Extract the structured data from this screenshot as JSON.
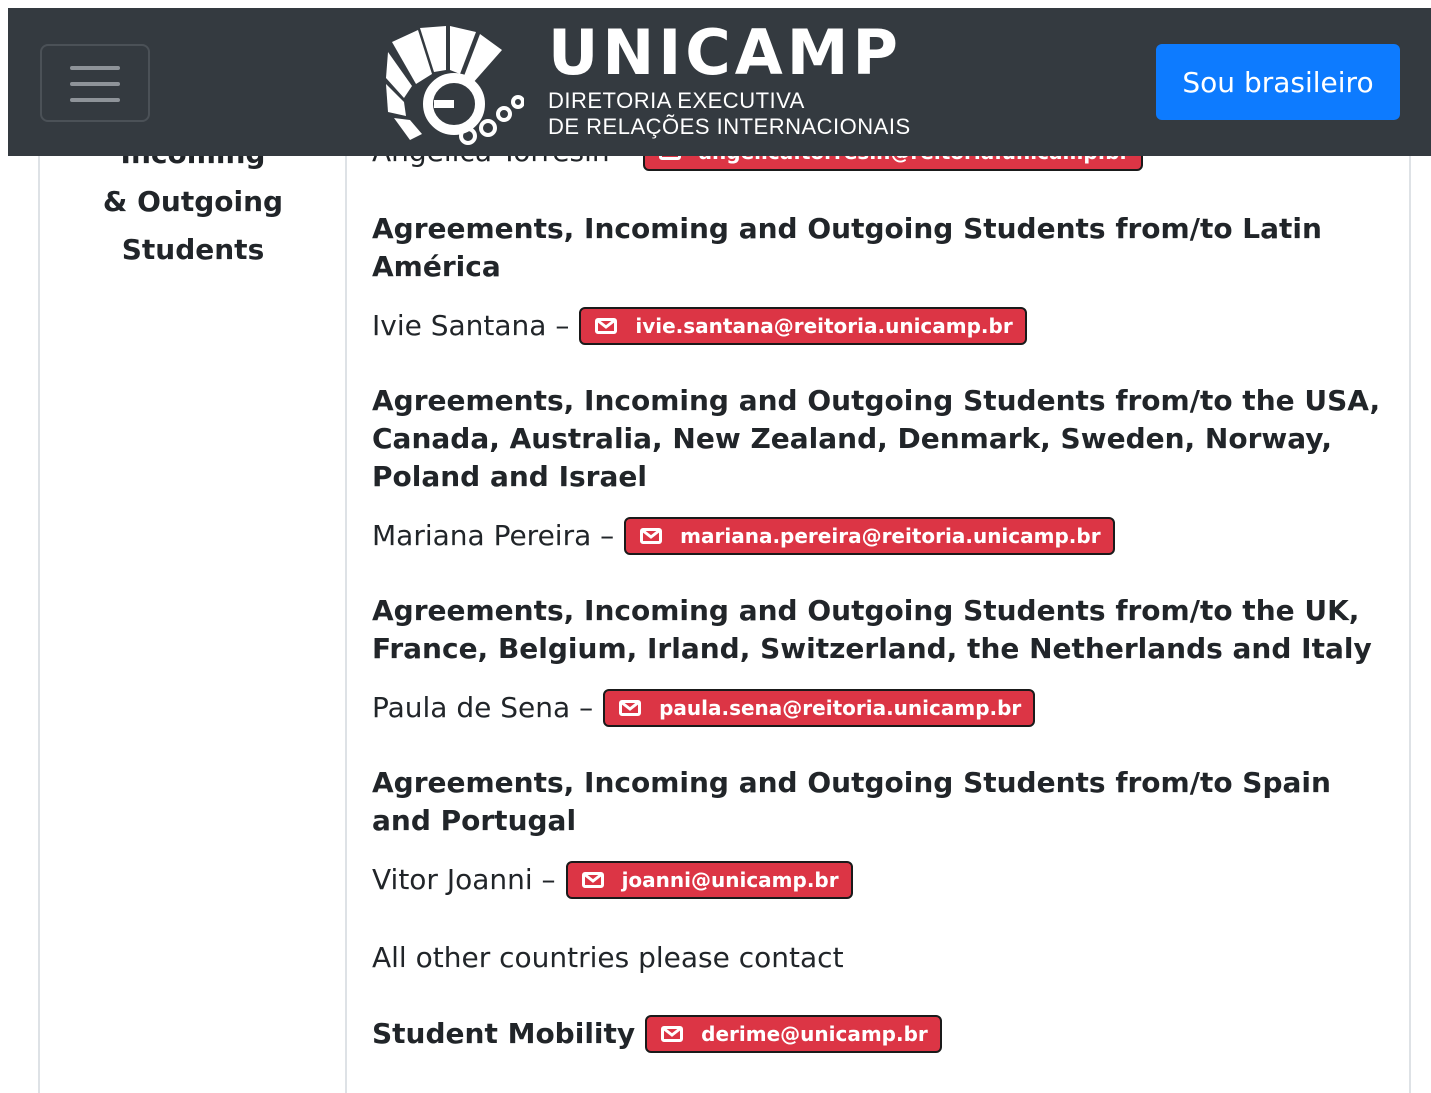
{
  "header": {
    "logo_title": "UNICAMP",
    "logo_sub_line1": "DIRETORIA EXECUTIVA",
    "logo_sub_line2": "DE RELAÇÕES INTERNACIONAIS",
    "lang_button": "Sou brasileiro",
    "accent": "#0d7bff",
    "bar_color": "#343a40"
  },
  "left_cell": {
    "line1": "Incoming",
    "line2": "& Outgoing",
    "line3": "Students"
  },
  "sections": [
    {
      "partial_person": "Angelica Torresin –",
      "partial_email": "angelica.torresin@reitoria.unicamp.br"
    },
    {
      "heading": "Agreements, Incoming and Outgoing Students from/to Latin América",
      "person": "Ivie Santana –",
      "email": "ivie.santana@reitoria.unicamp.br"
    },
    {
      "heading": "Agreements, Incoming and Outgoing Students from/to the USA, Canada, Australia, New Zealand, Denmark, Sweden, Norway, Poland and Israel",
      "person": "Mariana Pereira –",
      "email": "mariana.pereira@reitoria.unicamp.br"
    },
    {
      "heading": "Agreements, Incoming and Outgoing Students from/to the UK, France, Belgium, Irland, Switzerland, the Netherlands and Italy",
      "person": "Paula de Sena –",
      "email": "paula.sena@reitoria.unicamp.br"
    },
    {
      "heading": "Agreements, Incoming and Outgoing Students from/to Spain and Portugal",
      "person": "Vitor Joanni –",
      "email": "joanni@unicamp.br"
    }
  ],
  "other_countries": "All other countries please contact",
  "student_mobility": {
    "label": "Student Mobility",
    "email": "derime@unicamp.br"
  },
  "icons": {
    "menu": "hamburger-menu-icon",
    "email": "envelope-icon",
    "logo": "unicamp-logo-icon"
  },
  "badge_color": "#dc3545"
}
